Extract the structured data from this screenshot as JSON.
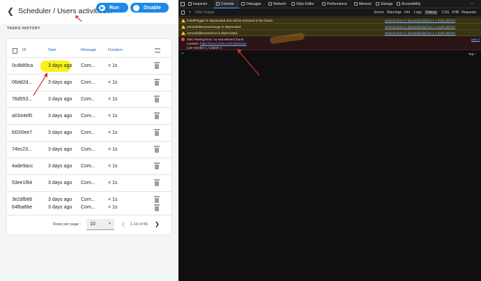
{
  "app": {
    "title": "Scheduler / Users activities...",
    "run_label": "Run",
    "disable_label": "Disable",
    "section_label": "TASKS HISTORY",
    "columns": [
      "ID",
      "Start",
      "Message",
      "Duration"
    ],
    "rows": [
      {
        "id": "0c4b89ca",
        "start": "3 days ago",
        "message": "Com...",
        "duration": "< 1s"
      },
      {
        "id": "06dd2d...",
        "start": "3 days ago",
        "message": "Com...",
        "duration": "< 1s"
      },
      {
        "id": "76d553...",
        "start": "3 days ago",
        "message": "Com...",
        "duration": "< 1s"
      },
      {
        "id": "a0344ef0",
        "start": "3 days ago",
        "message": "Com...",
        "duration": "< 1s"
      },
      {
        "id": "fd200ee7",
        "start": "3 days ago",
        "message": "Com...",
        "duration": "< 1s"
      },
      {
        "id": "74ec23...",
        "start": "3 days ago",
        "message": "Com...",
        "duration": "< 1s"
      },
      {
        "id": "4ade9acc",
        "start": "3 days ago",
        "message": "Com...",
        "duration": "< 1s"
      },
      {
        "id": "53ee1f64",
        "start": "3 days ago",
        "message": "Com...",
        "duration": "< 1s"
      },
      {
        "id": "3e2dfb66",
        "start": "3 days ago",
        "message": "Com...",
        "duration": "< 1s"
      },
      {
        "id": "64fba6be",
        "start": "3 days ago",
        "message": "Com...",
        "duration": "< 1s"
      }
    ],
    "footer": {
      "rows_per_page_label": "Rows per page :",
      "rows_per_page_value": "10",
      "range": "1-10 of 66"
    }
  },
  "devtools": {
    "tabs": [
      "Inspector",
      "Console",
      "Debugger",
      "Network",
      "Style Editor",
      "Performance",
      "Memory",
      "Storage",
      "Accessibility"
    ],
    "filter_placeholder": "Filter Output",
    "filter_tabs": [
      "Errors",
      "Warnings",
      "Info",
      "Logs",
      "Debug",
      "CSS",
      "XHR",
      "Requests"
    ],
    "messages": [
      {
        "text": "InstallTrigger is deprecated and will be removed in the future.",
        "source": "services line 2 > injectedScript line 1 > eval:1:90734"
      },
      {
        "text": "onmozfullscreenchange is deprecated.",
        "source": "services line 2 > injectedScript line 1 > eval:1:90734"
      },
      {
        "text": "onmozfullscreenerror is deprecated.",
        "source": "services line 2 > injectedScript line 1 > eval:1:90734"
      }
    ],
    "error": {
      "line1": "XML Parsing Error: no root element found",
      "line2_prefix": "Location: ",
      "line2_link": "https://cloud.ivumt.net/m/jobs/user",
      "line3": "Line Number 1, Column 1:",
      "source": "user:1"
    },
    "prompt": "»",
    "context": "Top ÷"
  },
  "colors": {
    "accent": "#1e88e5",
    "highlight": "#f5f000",
    "annotation": "#d32f2f",
    "console_bg": "#0f0f11"
  }
}
